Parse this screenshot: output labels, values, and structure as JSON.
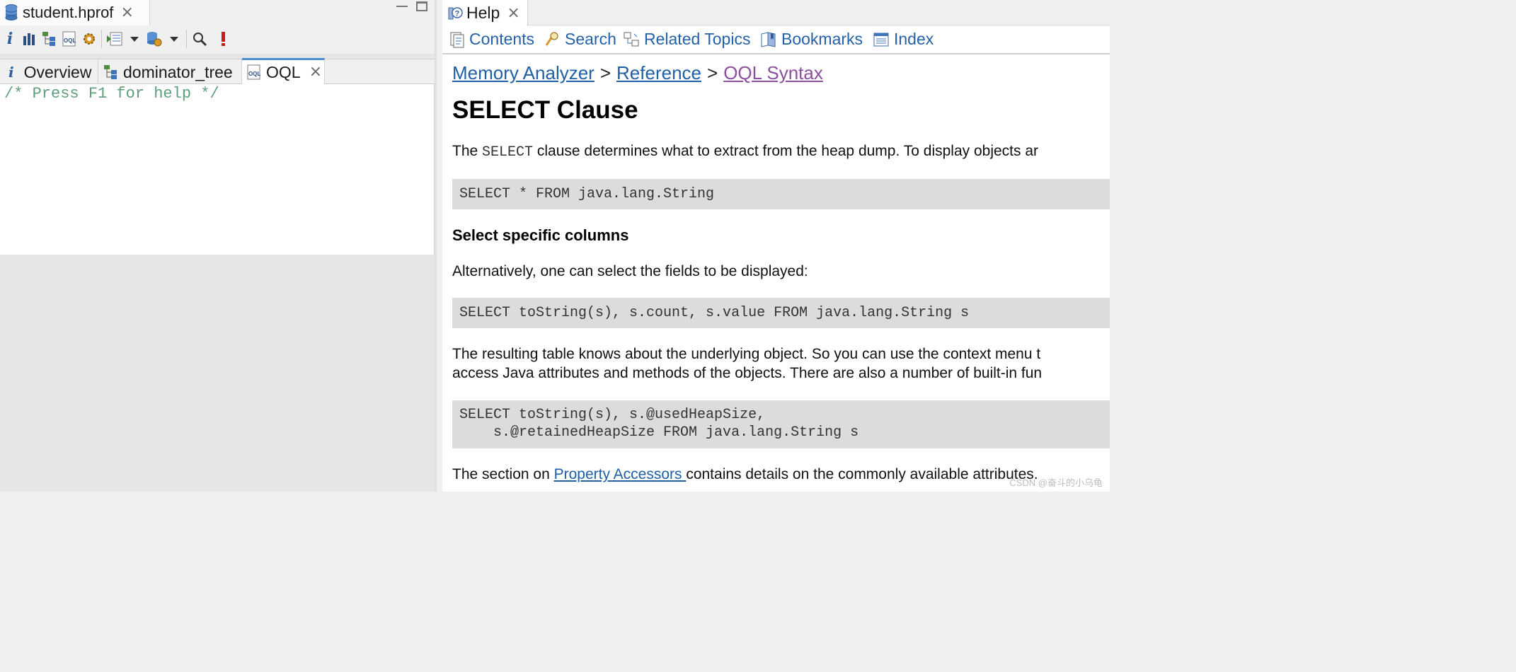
{
  "left_pane": {
    "editor_tab": {
      "label": "student.hprof",
      "icon": "database-icon"
    },
    "toolbar": {
      "icons": [
        "info-icon",
        "histogram-icon",
        "dominator-tree-icon",
        "oql-icon",
        "gear-icon",
        "query-browser-icon",
        "dropdown-icon",
        "heap-dump-overview-icon",
        "dropdown-icon",
        "search-icon",
        "leak-suspects-icon"
      ]
    },
    "inner_tabs": [
      {
        "label": "Overview",
        "icon": "info-icon"
      },
      {
        "label": "dominator_tree",
        "icon": "dominator-tree-icon"
      },
      {
        "label": "OQL",
        "icon": "oql-icon",
        "active": true
      }
    ],
    "editor_text": "/* Press F1 for help */"
  },
  "help_pane": {
    "tab": {
      "label": "Help",
      "icon": "help-icon"
    },
    "nav": [
      {
        "label": "Contents",
        "icon": "contents-icon"
      },
      {
        "label": "Search",
        "icon": "search-icon"
      },
      {
        "label": "Related Topics",
        "icon": "related-topics-icon"
      },
      {
        "label": "Bookmarks",
        "icon": "bookmarks-icon"
      },
      {
        "label": "Index",
        "icon": "index-icon"
      }
    ],
    "breadcrumbs": [
      "Memory Analyzer",
      "Reference",
      "OQL Syntax"
    ],
    "breadcrumb_separator": ">",
    "title": "SELECT Clause",
    "intro": {
      "before": "The ",
      "keyword": "SELECT",
      "after": " clause determines what to extract from the heap dump. To display objects ar"
    },
    "code1": "SELECT * FROM java.lang.String",
    "subheading": "Select specific columns",
    "para2": "Alternatively, one can select the fields to be displayed:",
    "code2": "SELECT toString(s), s.count, s.value FROM java.lang.String s",
    "para3_line1": "The resulting table knows about the underlying object. So you can use the context menu t",
    "para3_line2": "access Java attributes and methods of the objects. There are also a number of built-in fun",
    "code3_line1": "SELECT toString(s), s.@usedHeapSize,",
    "code3_line2": "    s.@retainedHeapSize FROM java.lang.String s",
    "para4": {
      "before": "The section on ",
      "link": "Property Accessors ",
      "after": "contains details on the commonly available attributes."
    }
  },
  "watermark": "CSDN @奋斗的小乌龟"
}
